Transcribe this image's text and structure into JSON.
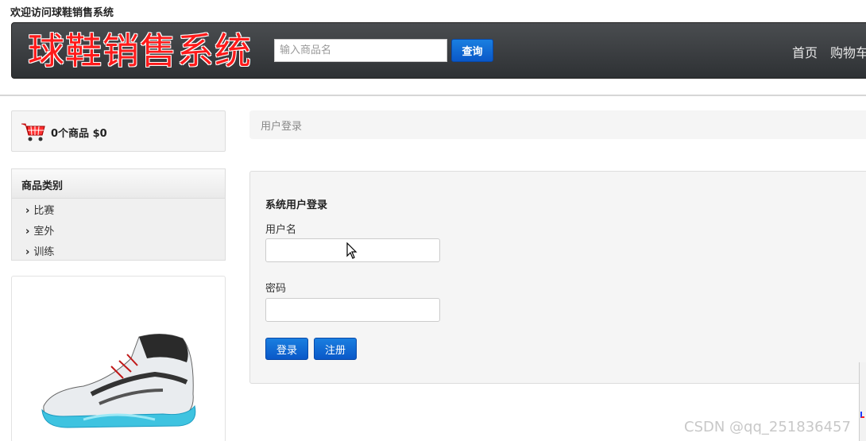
{
  "welcome_text": "欢迎访问球鞋销售系统",
  "header": {
    "logo_text": "球鞋销售系统",
    "search_placeholder": "输入商品名",
    "search_button": "查询",
    "nav": [
      "首页",
      "购物车"
    ]
  },
  "cart": {
    "summary": "0个商品 $0"
  },
  "categories": {
    "title": "商品类别",
    "items": [
      "比赛",
      "室外",
      "训练"
    ]
  },
  "breadcrumb": "用户登录",
  "login": {
    "title": "系统用户登录",
    "username_label": "用户名",
    "password_label": "密码",
    "login_button": "登录",
    "register_button": "注册"
  },
  "watermark": "CSDN @qq_251836457",
  "colors": {
    "logo_red": "#ff1a1a",
    "button_blue": "#0a58c8",
    "header_dark": "#2e3134"
  }
}
